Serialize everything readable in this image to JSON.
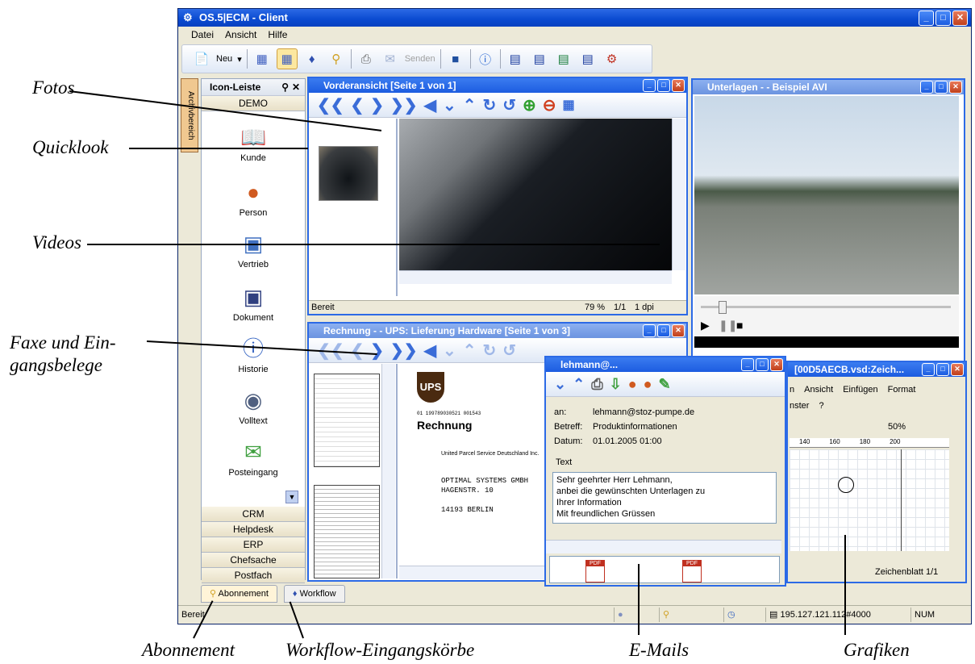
{
  "app": {
    "title": "OS.5|ECM - Client"
  },
  "menu": [
    "Datei",
    "Ansicht",
    "Hilfe"
  ],
  "toolbar": {
    "new_label": "Neu",
    "send_label": "Senden"
  },
  "sidebar": {
    "tab": "Archivbereich",
    "panel_title": "Icon-Leiste",
    "group_top": "DEMO",
    "items": [
      {
        "label": "Kunde",
        "icon": "book-icon"
      },
      {
        "label": "Person",
        "icon": "person-icon"
      },
      {
        "label": "Vertrieb",
        "icon": "cash-register-icon"
      },
      {
        "label": "Dokument",
        "icon": "document-icon"
      },
      {
        "label": "Historie",
        "icon": "info-doc-icon"
      },
      {
        "label": "Volltext",
        "icon": "binoculars-icon"
      },
      {
        "label": "Posteingang",
        "icon": "inbox-icon"
      }
    ],
    "groups": [
      "CRM",
      "Helpdesk",
      "ERP",
      "Chefsache",
      "Postfach"
    ]
  },
  "vorderansicht": {
    "title": "Vorderansicht [Seite 1 von 1]",
    "status": "Bereit",
    "zoom": "79 %",
    "page": "1/1",
    "dpi": "1 dpi"
  },
  "unterlagen": {
    "title": "Unterlagen -  - Beispiel AVI"
  },
  "rechnung": {
    "title": "Rechnung -  - UPS: Lieferung Hardware [Seite 1 von 3]",
    "doc_heading": "Rechnung",
    "doc_number": "01     199789030521  001543",
    "line1": "United Parcel Service Deutschland Inc.",
    "addr1": "OPTIMAL SYSTEMS GMBH",
    "addr2": "HAGENSTR. 10",
    "addr3": "14193 BERLIN"
  },
  "email": {
    "title": "lehmann@...",
    "to_label": "an:",
    "to": "lehmann@stoz-pumpe.de",
    "subject_label": "Betreff:",
    "subject": "Produktinformationen",
    "date_label": "Datum:",
    "date": "01.01.2005  01:00",
    "text_label": "Text",
    "body": [
      "Sehr geehrter Herr Lehmann,",
      "anbei die gewünschten Unterlagen zu",
      "Ihrer Information",
      "Mit freundlichen Grüssen"
    ],
    "attach": "PDF"
  },
  "visio": {
    "title": "[00D5AECB.vsd:Zeich...",
    "menu": [
      "n",
      "Ansicht",
      "Einfügen",
      "Format",
      "nster",
      "?"
    ],
    "zoom": "50%",
    "ruler": [
      "140",
      "160",
      "180",
      "200"
    ],
    "sheet": "Zeichenblatt 1/1"
  },
  "tabs": {
    "abonnement": "Abonnement",
    "workflow": "Workflow"
  },
  "statusbar": {
    "left": "Bereit",
    "ip": "195.127.121.112#4000",
    "num": "NUM"
  },
  "annotations": {
    "fotos": "Fotos",
    "quicklook": "Quicklook",
    "videos": "Videos",
    "faxe1": "Faxe und Ein-",
    "faxe2": "gangsbelege",
    "abonnement": "Abonnement",
    "workflow": "Workflow-Eingangskörbe",
    "emails": "E-Mails",
    "grafiken": "Grafiken"
  }
}
